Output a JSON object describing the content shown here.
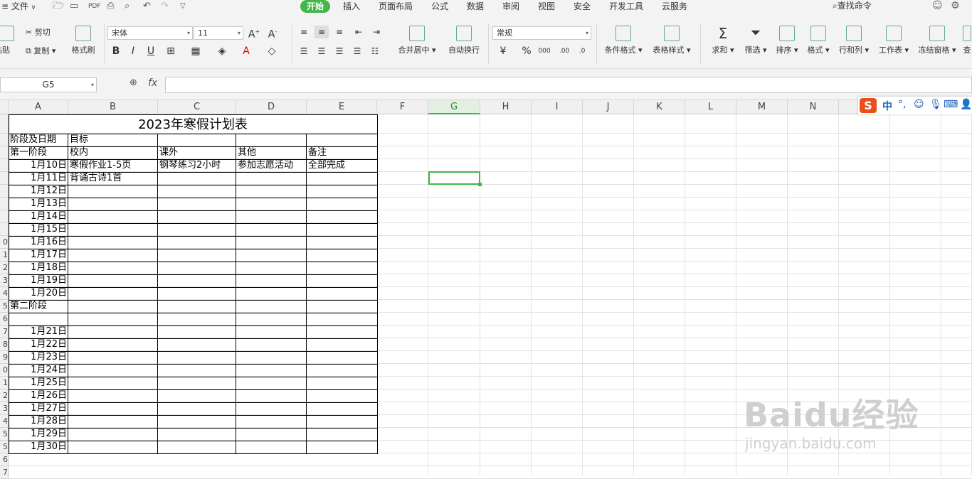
{
  "menubar": {
    "file": "文件",
    "tabs": [
      "开始",
      "插入",
      "页面布局",
      "公式",
      "数据",
      "审阅",
      "视图",
      "安全",
      "开发工具",
      "云服务"
    ],
    "active_tab": "开始",
    "search": "查找命令"
  },
  "ribbon": {
    "paste": "粘贴",
    "cut": "剪切",
    "copy": "复制",
    "format_painter": "格式刷",
    "font_name": "宋体",
    "font_size": "11",
    "bold": "B",
    "italic": "I",
    "underline": "U",
    "merge_center": "合并居中",
    "auto_wrap": "自动换行",
    "number_format": "常规",
    "percent": "%",
    "cond_format": "条件格式",
    "table_style": "表格样式",
    "sum": "求和",
    "filter": "筛选",
    "sort": "排序",
    "format": "格式",
    "row_col": "行和列",
    "worksheet": "工作表",
    "freeze": "冻结窗格",
    "find": "查"
  },
  "formula_bar": {
    "name_box": "G5",
    "fx": "fx",
    "value": ""
  },
  "columns": [
    "A",
    "B",
    "C",
    "D",
    "E",
    "F",
    "G",
    "H",
    "I",
    "J",
    "K",
    "L",
    "M",
    "N"
  ],
  "selected_column": "G",
  "row_numbers": [
    "",
    "",
    "",
    "",
    "",
    "",
    "",
    "",
    "",
    "0",
    "1",
    "2",
    "3",
    "4",
    "5",
    "6",
    "7",
    "8",
    "9",
    "0",
    "1",
    "2",
    "3",
    "4",
    "5",
    "5",
    "6",
    "7"
  ],
  "sheet": {
    "title": "2023年寒假计划表",
    "row2": {
      "a": "阶段及日期",
      "b": "目标"
    },
    "row3": {
      "a": "第一阶段",
      "b": "校内",
      "c": "课外",
      "d": "其他",
      "e": "备注"
    },
    "row4": {
      "a": "1月10日",
      "b": "寒假作业1-5页",
      "c": "钢琴练习2小时",
      "d": "参加志愿活动",
      "e": "全部完成"
    },
    "row5": {
      "a": "1月11日",
      "b": "背诵古诗1首"
    },
    "dates_block1": [
      "1月12日",
      "1月13日",
      "1月14日",
      "1月15日",
      "1月16日",
      "1月17日",
      "1月18日",
      "1月19日",
      "1月20日"
    ],
    "stage2": "第二阶段",
    "dates_block2": [
      "1月21日",
      "1月22日",
      "1月23日",
      "1月24日",
      "1月25日",
      "1月26日",
      "1月27日",
      "1月28日",
      "1月29日",
      "1月30日"
    ]
  },
  "ime": {
    "logo": "S",
    "lang": "中"
  },
  "watermark": {
    "logo": "Baidu经验",
    "url": "jingyan.baidu.com"
  }
}
